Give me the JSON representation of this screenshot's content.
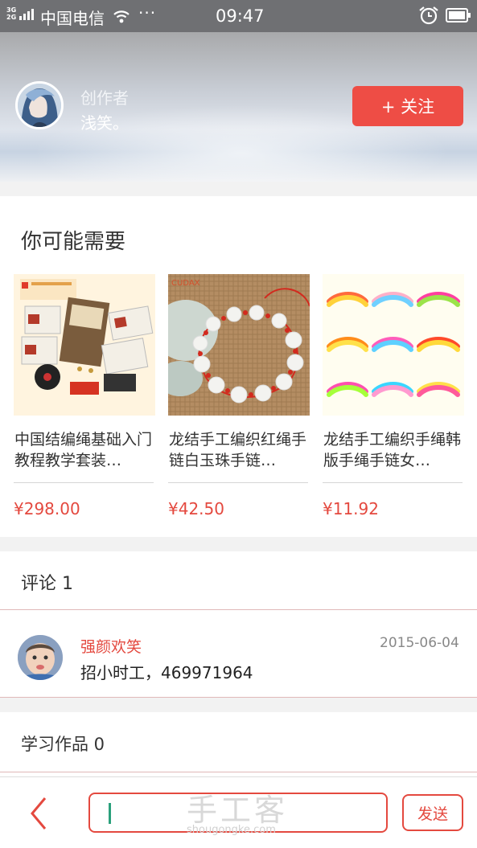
{
  "status_bar": {
    "network": "3G\n2G",
    "carrier": "中国电信",
    "more": "···",
    "time": "09:47",
    "icons": [
      "signal-icon",
      "wifi-icon",
      "alarm-icon",
      "battery-icon"
    ]
  },
  "author": {
    "role": "创作者",
    "name": "浅笑。",
    "follow_label": "+ 关注"
  },
  "recommend": {
    "title": "你可能需要",
    "products": [
      {
        "name": "中国结编绳基础入门教程教学套装…",
        "price": "¥298.00"
      },
      {
        "name": "龙结手工编织红绳手链白玉珠手链…",
        "price": "¥42.50"
      },
      {
        "name": "龙结手工编织手绳韩版手绳手链女…",
        "price": "¥11.92"
      }
    ]
  },
  "comments": {
    "title": "评论 1",
    "items": [
      {
        "user": "强颜欢笑",
        "date": "2015-06-04",
        "text": "招小时工，469971964"
      }
    ]
  },
  "works": {
    "title": "学习作品 0"
  },
  "bottom_bar": {
    "input_value": "",
    "watermark": "手工客",
    "watermark_url": "shougongke.com",
    "send_label": "发送"
  },
  "colors": {
    "accent": "#ee4d45",
    "price": "#e4493f",
    "status_bar": "#6f7073"
  }
}
